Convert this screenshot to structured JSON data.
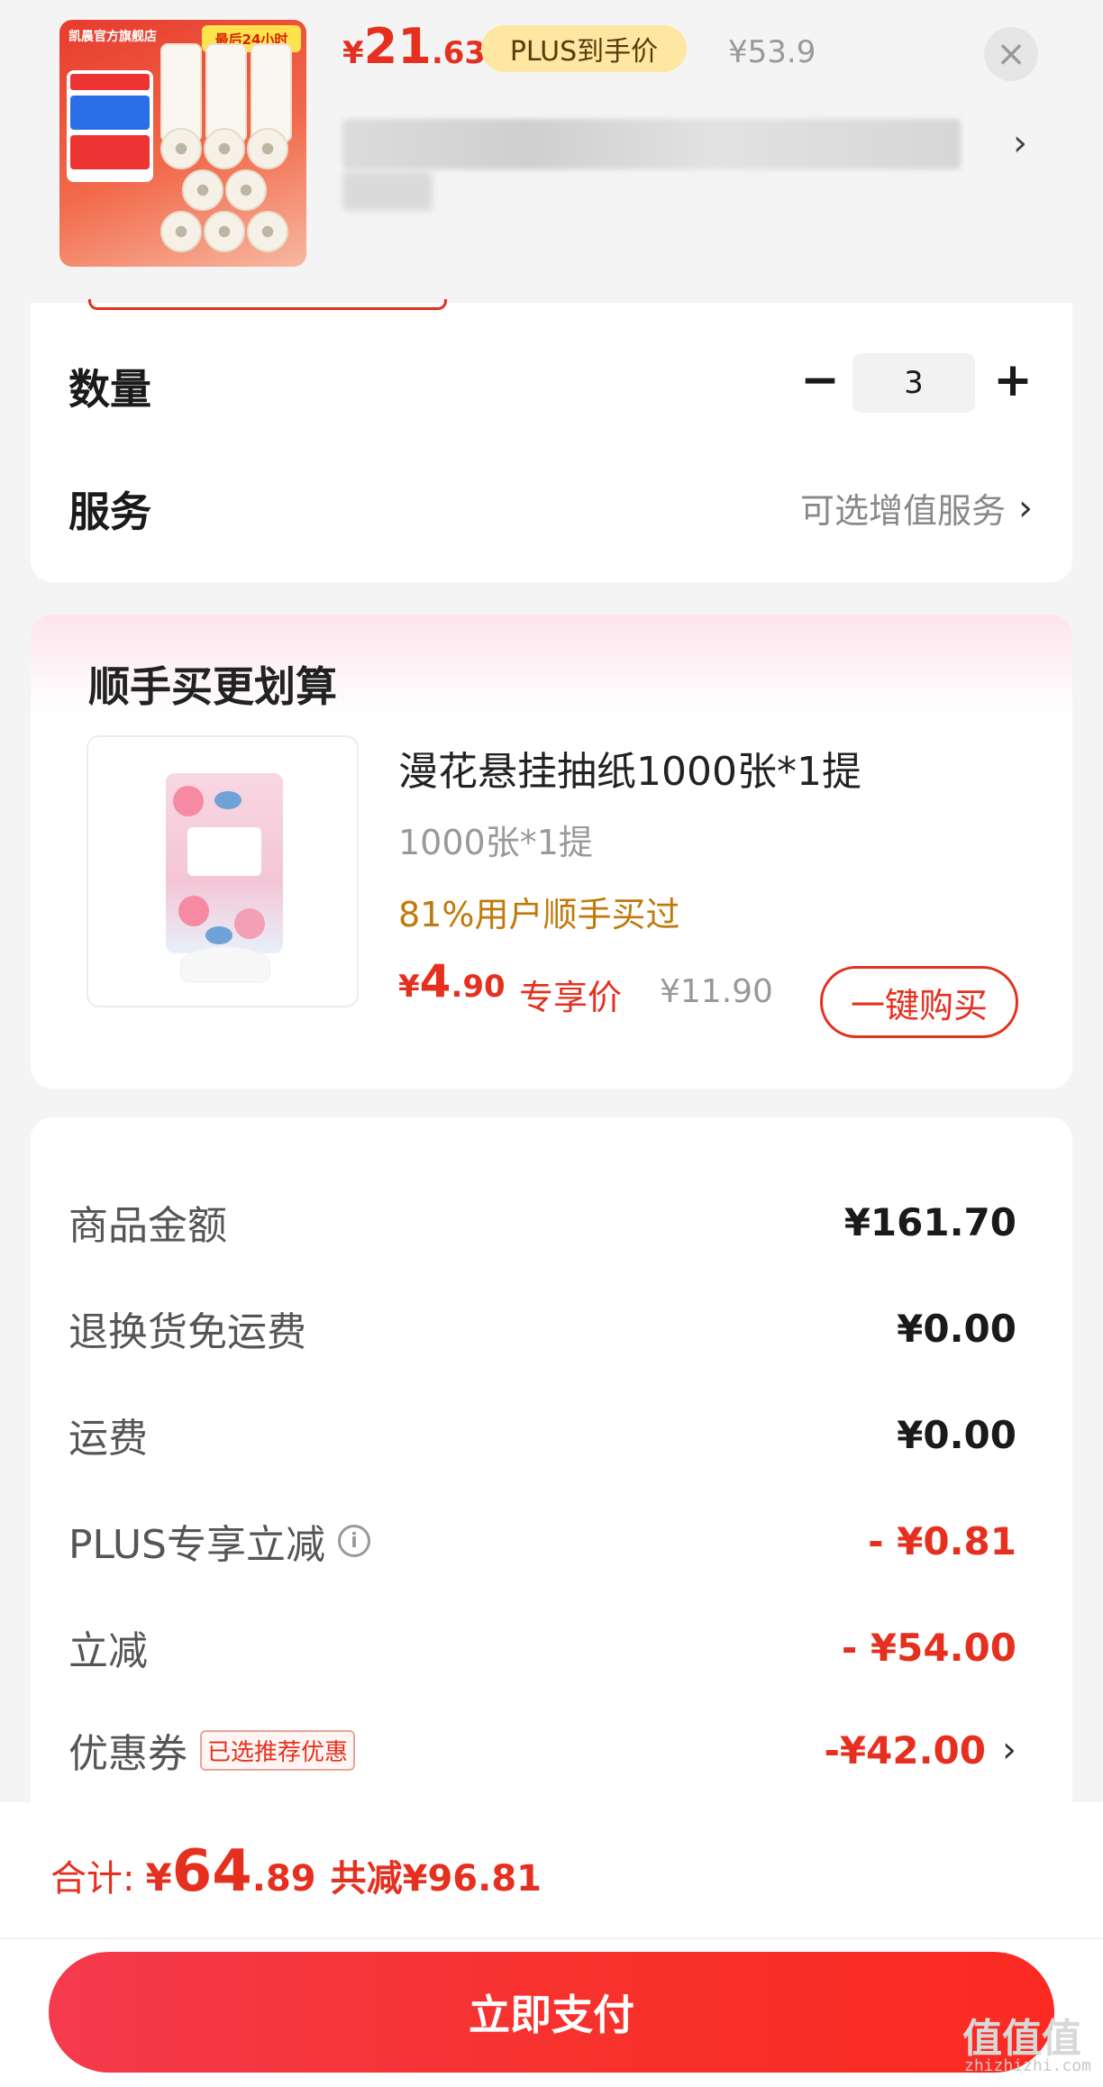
{
  "header": {
    "thumb_shop": "凯晨官方旗舰店",
    "thumb_banner": "最后24小时",
    "price_yen": "¥",
    "price_int": "21",
    "price_dec": ".63",
    "plus_badge": "PLUS到手价",
    "original_price": "¥53.9",
    "close_icon": "×",
    "chevron": "›"
  },
  "options": {
    "quantity_label": "数量",
    "minus": "−",
    "quantity_value": "3",
    "plus": "+",
    "service_label": "服务",
    "service_option": "可选增值服务",
    "chevron": "›"
  },
  "addon": {
    "section_title": "顺手买更划算",
    "product_name": "漫花悬挂抽纸1000张*1提",
    "spec": "1000张*1提",
    "bought_note": "81%用户顺手买过",
    "price_yen": "¥",
    "price_int": "4",
    "price_dec": ".90",
    "exclusive_label": "专享价",
    "original_price": "¥11.90",
    "buy_button": "一键购买"
  },
  "summary": {
    "rows": [
      {
        "label": "商品金额",
        "value": "¥161.70"
      },
      {
        "label": "退换货免运费",
        "value": "¥0.00"
      },
      {
        "label": "运费",
        "value": "¥0.00"
      },
      {
        "label": "PLUS专享立减",
        "value": "- ¥0.81"
      },
      {
        "label": "立减",
        "value": "- ¥54.00"
      },
      {
        "label": "优惠券",
        "value": "-¥42.00",
        "tag": "已选推荐优惠"
      }
    ],
    "info_icon": "i",
    "chevron": "›"
  },
  "footer": {
    "total_label": "合计:",
    "total_yen": "¥",
    "total_int": "64",
    "total_dec": ".89",
    "saved": "共减¥96.81",
    "pay_button": "立即支付",
    "watermark": "值值值",
    "watermark_url": "zhizhizhi.com"
  },
  "colors": {
    "accent_red": "#e6301f",
    "plus_gold": "#fde7a3",
    "bought_orange": "#c07a0c"
  }
}
